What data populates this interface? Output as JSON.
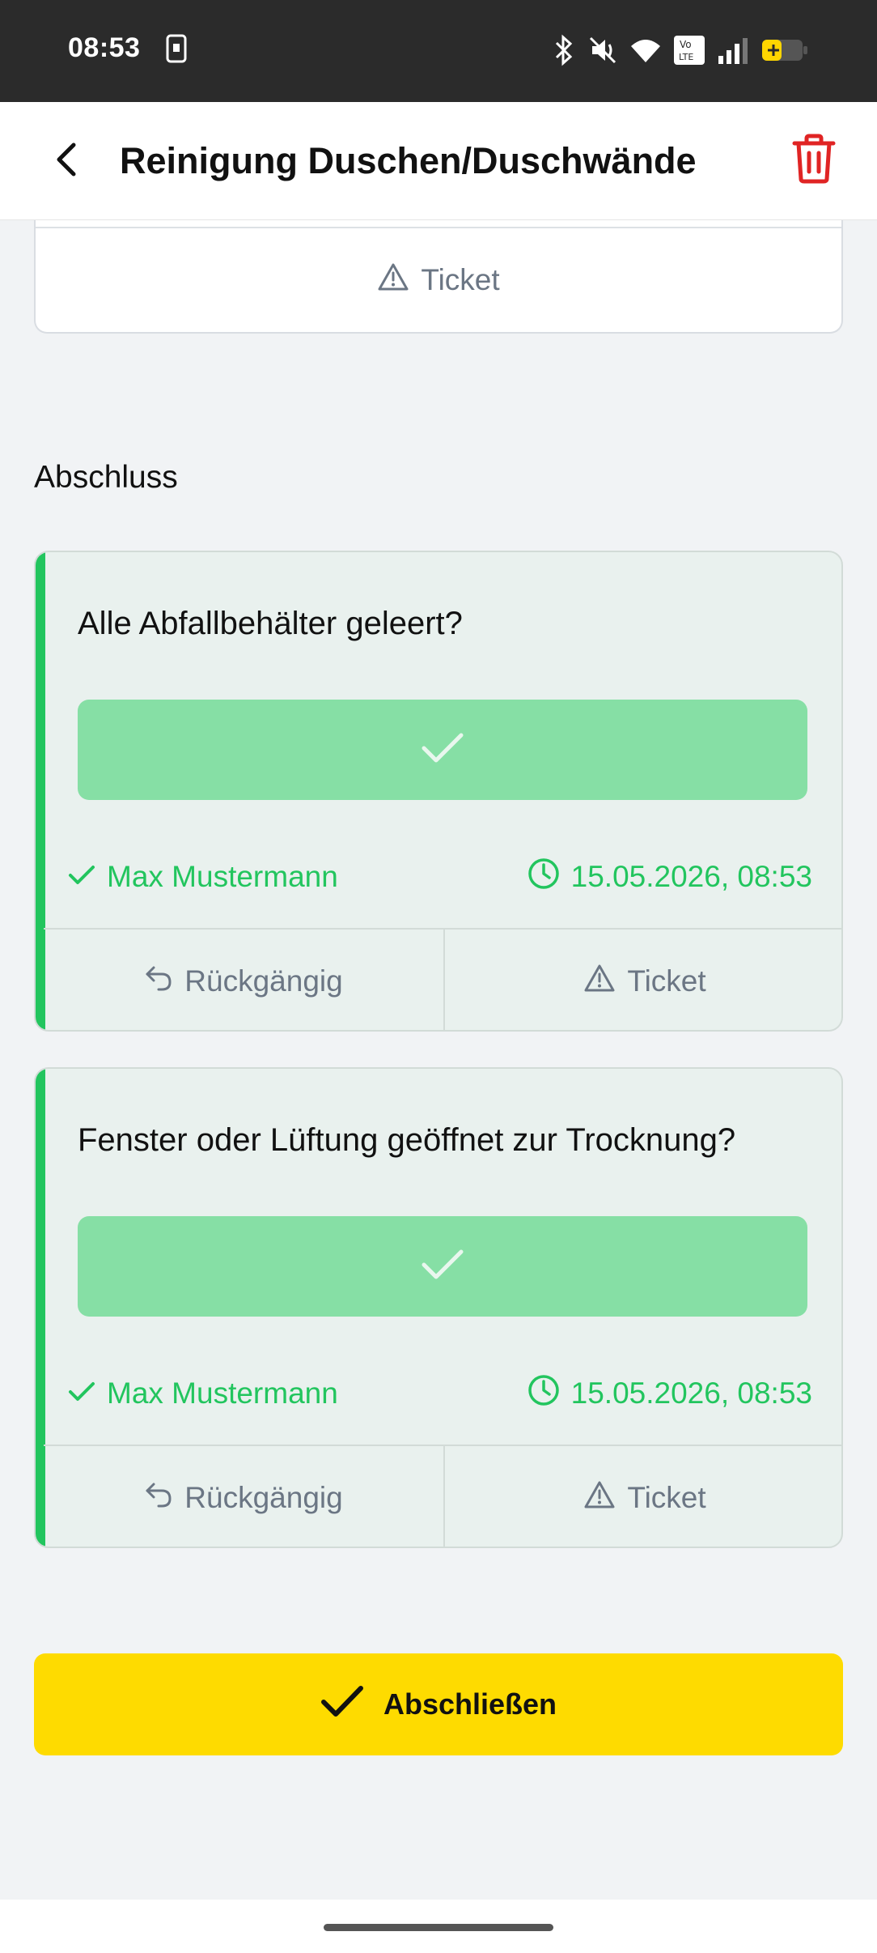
{
  "status_bar": {
    "time": "08:53",
    "icons": [
      "phone-notification-icon",
      "bluetooth-icon",
      "mute-icon",
      "wifi-icon",
      "volte-icon",
      "signal-icon",
      "battery-icon"
    ],
    "volte_label": "Vo LTE"
  },
  "app_bar": {
    "title": "Reinigung Duschen/Duschwände",
    "back_icon": "chevron-left-icon",
    "delete_icon": "trash-icon",
    "delete_color": "#e02424"
  },
  "previous_card": {
    "ticket_label": "Ticket"
  },
  "section": {
    "title": "Abschluss"
  },
  "tasks": [
    {
      "question": "Alle Abfallbehälter geleert?",
      "user": "Max Mustermann",
      "timestamp": "15.05.2026, 08:53",
      "undo_label": "Rückgängig",
      "ticket_label": "Ticket"
    },
    {
      "question": "Fenster oder Lüftung geöffnet zur Trocknung?",
      "user": "Max Mustermann",
      "timestamp": "15.05.2026, 08:53",
      "undo_label": "Rückgängig",
      "ticket_label": "Ticket"
    }
  ],
  "finish_button": {
    "label": "Abschließen"
  },
  "colors": {
    "accent_green": "#22c55e",
    "check_bar": "#86dfa5",
    "primary_yellow": "#fedb00",
    "muted_text": "#6b7684"
  }
}
